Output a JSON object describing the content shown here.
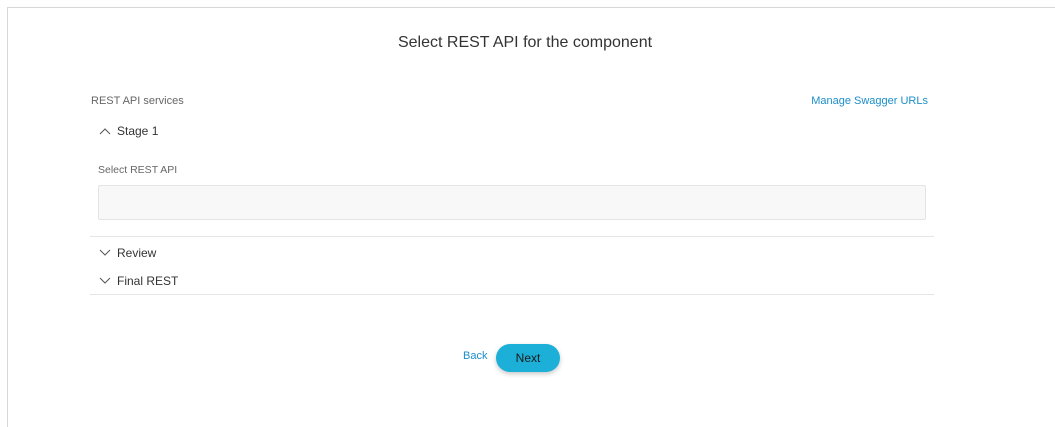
{
  "page": {
    "title": "Select REST API for the component"
  },
  "services": {
    "label": "REST API services",
    "manage_link": "Manage Swagger URLs"
  },
  "stages": [
    {
      "label": "Stage 1",
      "expanded": true
    },
    {
      "label": "Review",
      "expanded": false
    },
    {
      "label": "Final REST",
      "expanded": false
    }
  ],
  "stage1": {
    "field_label": "Select REST API",
    "input_value": ""
  },
  "footer": {
    "back_label": "Back",
    "next_label": "Next"
  },
  "colors": {
    "link": "#1c8ec9",
    "primary_button": "#1cb0d8"
  },
  "icons": {
    "expanded": "chevron-up-icon",
    "collapsed": "chevron-down-icon"
  }
}
